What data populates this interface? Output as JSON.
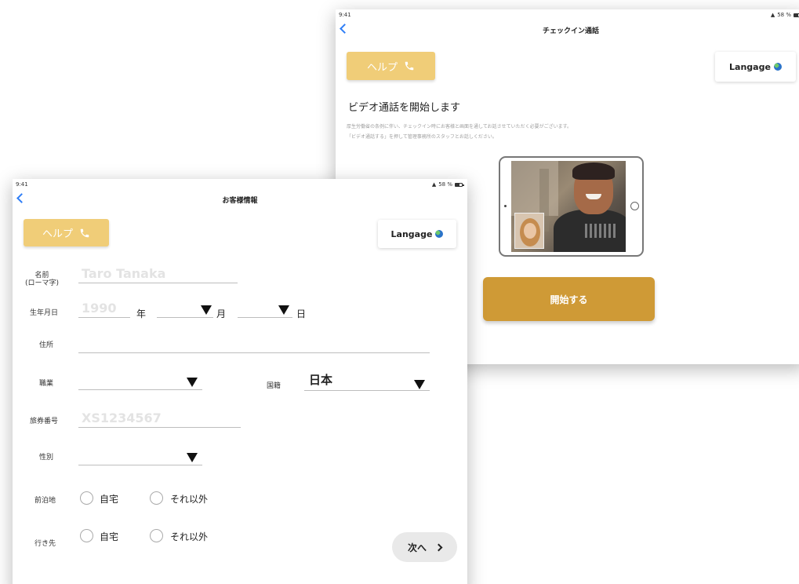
{
  "back_screen": {
    "status": {
      "time": "9:41",
      "battery": "58 %"
    },
    "nav_title": "チェックイン通話",
    "help_label": "ヘルプ",
    "language_label": "Langage",
    "heading": "ビデオ通話を開始します",
    "description_lines": [
      "厚生労働省の条例に伴い、チェックイン時にお客様と画面を通してお話させていただく必要がございます。",
      "「ビデオ通話する」を押して管理事務所のスタッフとお話しください。"
    ],
    "start_button_label": "開始する"
  },
  "front_screen": {
    "status": {
      "time": "9:41",
      "battery": "58 %"
    },
    "nav_title": "お客様情報",
    "help_label": "ヘルプ",
    "language_label": "Langage",
    "name": {
      "label_line1": "名前",
      "label_line2": "(ローマ字)",
      "placeholder": "Taro Tanaka"
    },
    "birthdate": {
      "label": "生年月日",
      "year_placeholder": "1990",
      "year_unit": "年",
      "month_unit": "月",
      "day_unit": "日"
    },
    "address": {
      "label": "住所"
    },
    "occupation": {
      "label": "職業"
    },
    "nationality": {
      "label": "国籍",
      "value": "日本"
    },
    "passport": {
      "label": "旅券番号",
      "placeholder": "XS1234567"
    },
    "gender": {
      "label": "性別"
    },
    "previous_stay": {
      "label": "前泊地",
      "options": [
        "自宅",
        "それ以外"
      ]
    },
    "destination": {
      "label": "行き先",
      "options": [
        "自宅",
        "それ以外"
      ]
    },
    "next_button_label": "次へ"
  }
}
